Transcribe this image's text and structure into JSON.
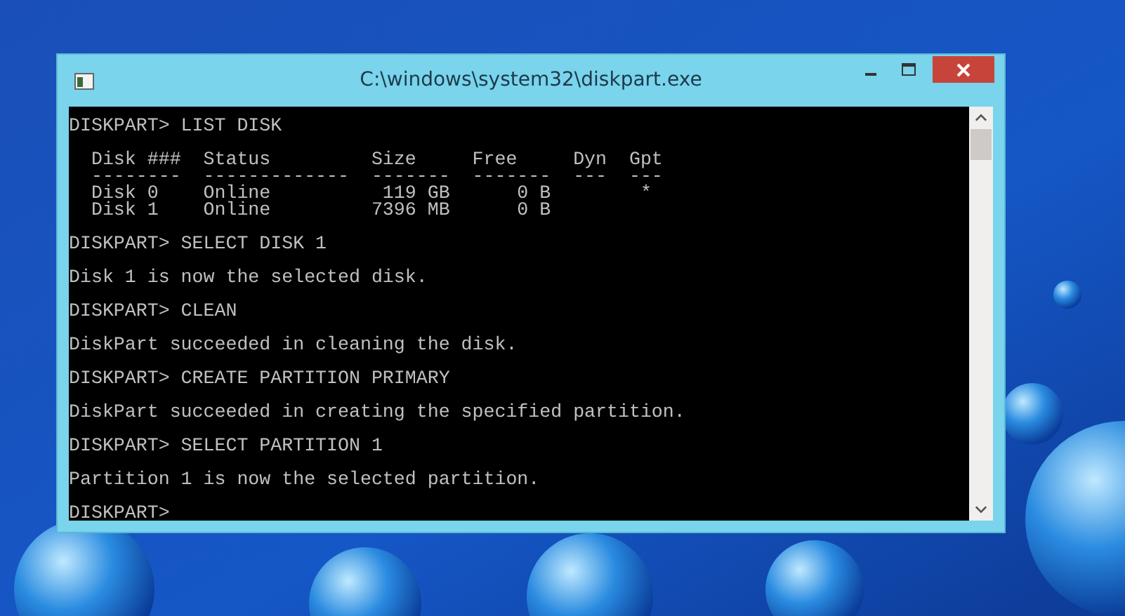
{
  "window": {
    "title": "C:\\windows\\system32\\diskpart.exe"
  },
  "console": {
    "blocks": [
      [
        "DISKPART> LIST DISK"
      ],
      [
        "  Disk ###  Status         Size     Free     Dyn  Gpt",
        "  --------  -------------  -------  -------  ---  ---",
        "  Disk 0    Online          119 GB      0 B        *",
        "  Disk 1    Online         7396 MB      0 B"
      ],
      [
        "DISKPART> SELECT DISK 1"
      ],
      [
        "Disk 1 is now the selected disk."
      ],
      [
        "DISKPART> CLEAN"
      ],
      [
        "DiskPart succeeded in cleaning the disk."
      ],
      [
        "DISKPART> CREATE PARTITION PRIMARY"
      ],
      [
        "DiskPart succeeded in creating the specified partition."
      ],
      [
        "DISKPART> SELECT PARTITION 1"
      ],
      [
        "Partition 1 is now the selected partition."
      ],
      [
        "DISKPART>"
      ]
    ]
  }
}
